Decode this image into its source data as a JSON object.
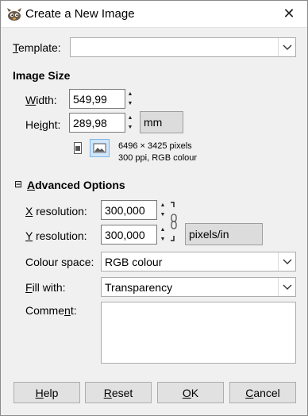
{
  "window": {
    "title": "Create a New Image",
    "close_glyph": "✕"
  },
  "template": {
    "label_pre": "",
    "label_key": "T",
    "label_post": "emplate:",
    "value": ""
  },
  "image_size": {
    "heading": "Image Size",
    "width": {
      "label_pre": "",
      "label_key": "W",
      "label_post": "idth:",
      "value": "549,99"
    },
    "height": {
      "label_pre": "He",
      "label_key": "i",
      "label_post": "ght:",
      "value": "289,98"
    },
    "unit": "mm",
    "info_line1": "6496 × 3425 pixels",
    "info_line2": "300 ppi, RGB colour",
    "orientation": {
      "portrait_icon": "portrait-icon",
      "landscape_icon": "landscape-icon",
      "selected": "landscape"
    }
  },
  "advanced": {
    "expander_glyph": "⊟",
    "heading_pre": "",
    "heading_key": "A",
    "heading_post": "dvanced Options",
    "x_res": {
      "label_pre": "",
      "label_key": "X",
      "label_post": " resolution:",
      "value": "300,000"
    },
    "y_res": {
      "label_pre": "",
      "label_key": "Y",
      "label_post": " resolution:",
      "value": "300,000"
    },
    "res_unit": "pixels/in",
    "colour_space": {
      "label": "Colour space:",
      "value": "RGB colour"
    },
    "fill": {
      "label_pre": "",
      "label_key": "F",
      "label_post": "ill with:",
      "value": "Transparency"
    },
    "comment": {
      "label_pre": "Comme",
      "label_key": "n",
      "label_post": "t:",
      "value": ""
    }
  },
  "buttons": {
    "help": {
      "pre": "",
      "key": "H",
      "post": "elp"
    },
    "reset": {
      "pre": "",
      "key": "R",
      "post": "eset"
    },
    "ok": {
      "pre": "",
      "key": "O",
      "post": "K"
    },
    "cancel": {
      "pre": "",
      "key": "C",
      "post": "ancel"
    }
  },
  "colors": {
    "window_bg": "#f0f0f0",
    "toggle_selected_bg": "#cfe6fb",
    "toggle_selected_border": "#7fb7e6"
  }
}
